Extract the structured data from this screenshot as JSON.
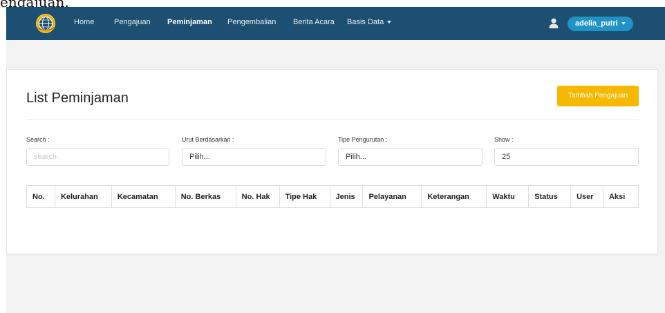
{
  "background_caption": "engajuan.",
  "navbar": {
    "items": [
      {
        "label": "Home"
      },
      {
        "label": "Pengajuan"
      },
      {
        "label": "Peminjaman"
      },
      {
        "label": "Pengembalian"
      },
      {
        "label": "Berita Acara"
      },
      {
        "label": "Basis Data"
      }
    ],
    "user_name": "adelia_putri",
    "colors": {
      "bar": "#1d4f73",
      "user_pill": "#1f93c6"
    }
  },
  "page": {
    "title": "List Peminjaman",
    "add_button": "Tambah Pengajuan",
    "accent": "#f6b800"
  },
  "filters": {
    "search_label": "Search :",
    "search_placeholder": "search",
    "sort_label": "Urut Berdasarkan :",
    "sort_value": "Pilih...",
    "order_label": "Tipe Pengurutan :",
    "order_value": "Pilih...",
    "show_label": "Show :",
    "show_value": "25"
  },
  "table": {
    "headers": [
      "No.",
      "Kelurahan",
      "Kecamatan",
      "No. Berkas",
      "No. Hak",
      "Tipe Hak",
      "Jenis",
      "Pelayanan",
      "Keterangan",
      "Waktu",
      "Status",
      "User",
      "Aksi"
    ],
    "rows": []
  }
}
